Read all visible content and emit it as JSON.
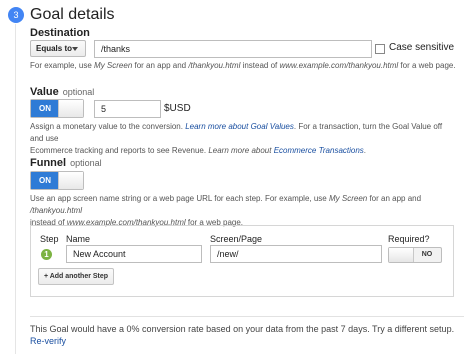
{
  "section": {
    "step_number": "3",
    "title": "Goal details"
  },
  "destination": {
    "label": "Destination",
    "match_type": "Equals to",
    "value": "/thanks",
    "case_sensitive_label": "Case sensitive",
    "case_sensitive_checked": false,
    "help_prefix": "For example, use ",
    "help_my_screen": "My Screen",
    "help_mid1": " for an app and ",
    "help_path": "/thankyou.html",
    "help_mid2": " instead of ",
    "help_url": "www.example.com/thankyou.html",
    "help_suffix": " for a web page."
  },
  "value": {
    "label": "Value",
    "optional": "optional",
    "toggle_state": "ON",
    "amount": "5",
    "currency": "$USD",
    "help_a": "Assign a monetary value to the conversion. ",
    "help_link1": "Learn more about Goal Values",
    "help_b": ". For a transaction, turn the Goal Value off and use",
    "help_c": "Ecommerce tracking and reports to see Revenue. ",
    "help_link2_prefix": "Learn more about ",
    "help_link2": "Ecommerce Transactions",
    "help_d": "."
  },
  "funnel": {
    "label": "Funnel",
    "optional": "optional",
    "toggle_state": "ON",
    "help_a": "Use an app screen name string or a web page URL for each step. For example, use ",
    "help_my_screen": "My Screen",
    "help_b": " for an app and ",
    "help_path": "/thankyou.html",
    "help_c": "instead of ",
    "help_url": "www.example.com/thankyou.html",
    "help_d": " for a web page.",
    "columns": {
      "step": "Step",
      "name": "Name",
      "screen": "Screen/Page",
      "required": "Required?"
    },
    "rows": [
      {
        "step": "1",
        "name": "New Account",
        "screen": "/new/",
        "required": "NO"
      }
    ],
    "add_step": "+ Add another Step"
  },
  "summary": "This Goal would have a 0% conversion rate based on your data from the past 7 days. Try a different setup.",
  "reverify": "Re-verify"
}
